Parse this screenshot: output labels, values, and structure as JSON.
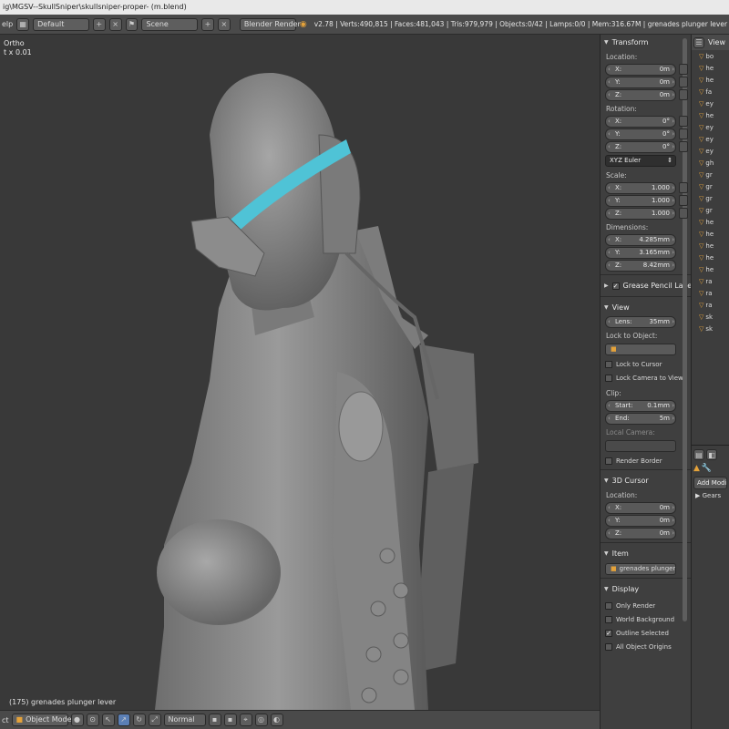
{
  "window_title": "ig\\MGSV--SkullSniper\\skullsniper-proper- (m.blend)",
  "header": {
    "menu_help": "elp",
    "layout": "Default",
    "scene": "Scene",
    "render_engine": "Blender Render",
    "stats": "v2.78 | Verts:490,815 | Faces:481,043 | Tris:979,979 | Objects:0/42 | Lamps:0/0 | Mem:316.67M | grenades plunger lever"
  },
  "viewport": {
    "view_label": "Ortho",
    "view_sub": "t x 0.01",
    "object_label": "(175) grenades plunger lever"
  },
  "footer": {
    "view_label": "ct",
    "mode": "Object Mode",
    "pivot": "Normal"
  },
  "properties": {
    "transform_title": "Transform",
    "location_label": "Location:",
    "location": [
      {
        "axis": "X:",
        "value": "0m"
      },
      {
        "axis": "Y:",
        "value": "0m"
      },
      {
        "axis": "Z:",
        "value": "0m"
      }
    ],
    "rotation_label": "Rotation:",
    "rotation": [
      {
        "axis": "X:",
        "value": "0°"
      },
      {
        "axis": "Y:",
        "value": "0°"
      },
      {
        "axis": "Z:",
        "value": "0°"
      }
    ],
    "rotation_mode": "XYZ Euler",
    "scale_label": "Scale:",
    "scale": [
      {
        "axis": "X:",
        "value": "1.000"
      },
      {
        "axis": "Y:",
        "value": "1.000"
      },
      {
        "axis": "Z:",
        "value": "1.000"
      }
    ],
    "dimensions_label": "Dimensions:",
    "dimensions": [
      {
        "axis": "X:",
        "value": "4.285mm"
      },
      {
        "axis": "Y:",
        "value": "3.165mm"
      },
      {
        "axis": "Z:",
        "value": "8.42mm"
      }
    ],
    "grease_pencil": "Grease Pencil Layers",
    "view_title": "View",
    "lens_label": "Lens:",
    "lens_value": "35mm",
    "lock_to_object": "Lock to Object:",
    "lock_to_cursor": "Lock to Cursor",
    "lock_camera": "Lock Camera to View",
    "clip_label": "Clip:",
    "clip_start_label": "Start:",
    "clip_start": "0.1mm",
    "clip_end_label": "End:",
    "clip_end": "5m",
    "local_camera": "Local Camera:",
    "render_border": "Render Border",
    "cursor_title": "3D Cursor",
    "cursor_location_label": "Location:",
    "cursor_location": [
      {
        "axis": "X:",
        "value": "0m"
      },
      {
        "axis": "Y:",
        "value": "0m"
      },
      {
        "axis": "Z:",
        "value": "0m"
      }
    ],
    "item_title": "Item",
    "item_name": "grenades plunger le...",
    "display_title": "Display",
    "only_render": "Only Render",
    "world_background": "World Background",
    "outline_selected": "Outline Selected",
    "all_object_origins": "All Object Origins"
  },
  "outliner": {
    "header": "View",
    "items": [
      "bo",
      "he",
      "he",
      "fa",
      "ey",
      "he",
      "ey",
      "ey",
      "ey",
      "gh",
      "gr",
      "gr",
      "gr",
      "gr",
      "he",
      "he",
      "he",
      "he",
      "he",
      "ra",
      "ra",
      "ra",
      "sk",
      "sk"
    ]
  },
  "modifiers": {
    "add_modifier": "Add Modifie",
    "gears": "Gears"
  },
  "colors": {
    "visor_cyan": "#4fc3d6",
    "model_grey": "#8e8e8e"
  }
}
